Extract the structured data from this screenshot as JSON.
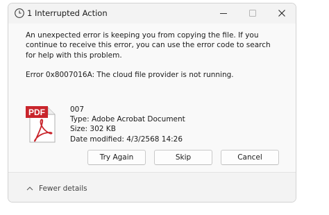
{
  "titlebar": {
    "title": "1 Interrupted Action",
    "icon": "clock-icon",
    "controls": [
      "minimize",
      "maximize",
      "close"
    ]
  },
  "message": {
    "text": "An unexpected error is keeping you from copying the file. If you continue to receive this error, you can use the error code to search for help with this problem.",
    "error": "Error 0x8007016A: The cloud file provider is not running."
  },
  "file": {
    "icon": "pdf-file-icon",
    "icon_badge": "PDF",
    "name": "007",
    "type": "Type: Adobe Acrobat Document",
    "size": "Size: 302 KB",
    "modified": "Date modified: 4/3/2568 14:26"
  },
  "buttons": {
    "try_again": "Try Again",
    "skip": "Skip",
    "cancel": "Cancel"
  },
  "footer": {
    "details_label": "Fewer details"
  },
  "colors": {
    "pdf_red": "#c9252c",
    "titlebar_bg": "#f3f3f3",
    "content_bg": "#f9f9f9"
  }
}
